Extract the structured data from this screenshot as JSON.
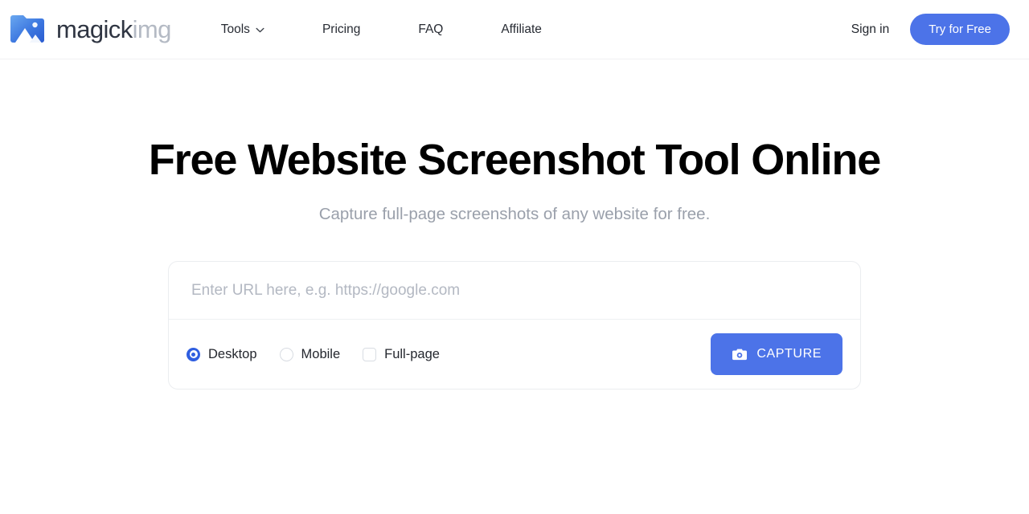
{
  "header": {
    "brand": {
      "icon": "image-folder-logo-icon",
      "text_dark": "magick",
      "text_light": "img"
    },
    "nav_items": [
      {
        "label": "Tools",
        "icon": "chevron-down-icon",
        "has_dropdown": true
      },
      {
        "label": "Pricing",
        "has_dropdown": false
      },
      {
        "label": "FAQ",
        "has_dropdown": false
      },
      {
        "label": "Affiliate",
        "has_dropdown": false
      }
    ],
    "sign_in_label": "Sign in",
    "try_free_label": "Try for Free"
  },
  "hero": {
    "title": "Free Website Screenshot Tool Online",
    "subtitle": "Capture full-page screenshots of any website for free."
  },
  "capture_card": {
    "url_input": {
      "value": "",
      "placeholder": "Enter URL here, e.g. https://google.com"
    },
    "options": [
      {
        "label": "Desktop",
        "control": "radio",
        "selected": true
      },
      {
        "label": "Mobile",
        "control": "radio",
        "selected": false
      },
      {
        "label": "Full-page",
        "control": "checkbox",
        "selected": false
      }
    ],
    "capture_button": {
      "label": "CAPTURE",
      "icon": "camera-icon"
    }
  },
  "colors": {
    "accent_blue": "#4c73e8",
    "radio_blue": "#2f5ee0",
    "brand_dark": "#2f3542",
    "brand_light": "#b4bac4",
    "subtitle_gray": "#9aa0ab",
    "placeholder_gray": "#b3b8c2",
    "border_gray": "#ebedf0"
  }
}
